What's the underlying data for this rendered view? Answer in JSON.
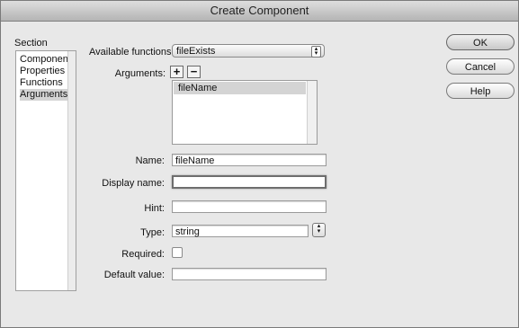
{
  "window": {
    "title": "Create Component"
  },
  "section": {
    "heading": "Section",
    "items": [
      {
        "label": "Component"
      },
      {
        "label": "Properties"
      },
      {
        "label": "Functions"
      },
      {
        "label": "Arguments"
      }
    ],
    "selected": "Arguments"
  },
  "form": {
    "available_functions_label": "Available functions:",
    "available_functions_value": "fileExists",
    "arguments_label": "Arguments:",
    "add_symbol": "+",
    "remove_symbol": "−",
    "arguments": [
      "fileName"
    ],
    "name_label": "Name:",
    "name_value": "fileName",
    "display_name_label": "Display name:",
    "display_name_value": "",
    "hint_label": "Hint:",
    "hint_value": "",
    "type_label": "Type:",
    "type_value": "string",
    "required_label": "Required:",
    "required_checked": false,
    "default_value_label": "Default value:",
    "default_value_value": ""
  },
  "buttons": {
    "ok": "OK",
    "cancel": "Cancel",
    "help": "Help"
  }
}
